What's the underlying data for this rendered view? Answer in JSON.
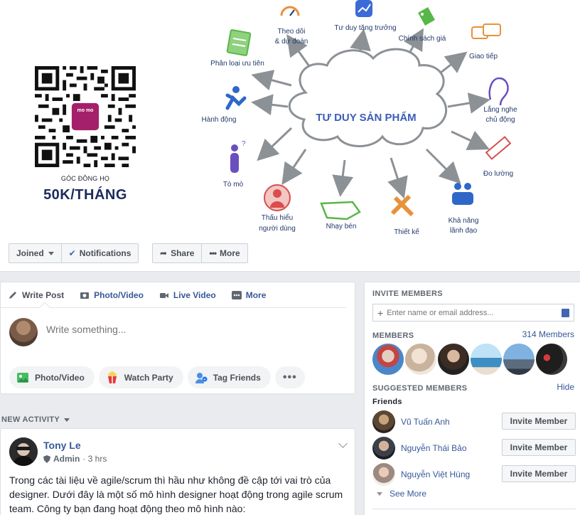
{
  "cover": {
    "qr_caption": "GÓC ĐỒNG HỌ",
    "qr_price": "50K/THÁNG",
    "qr_logo": "mo mo",
    "mindmap": {
      "center": "TƯ DUY SẢN PHẨM",
      "nodes": [
        {
          "label": "Theo dõi",
          "label2": "& dự đoán",
          "icon": "speedometer-icon"
        },
        {
          "label": "Tư duy tăng trưởng",
          "icon": "growth-chart-icon"
        },
        {
          "label": "Chính sách giá",
          "icon": "price-tag-icon"
        },
        {
          "label": "Giao tiếp",
          "icon": "chat-bubbles-icon"
        },
        {
          "label": "Lắng nghe",
          "label2": "chủ động",
          "icon": "ear-icon"
        },
        {
          "label": "Đo lường",
          "icon": "ruler-icon"
        },
        {
          "label": "Khả năng",
          "label2": "lãnh đạo",
          "icon": "team-icon"
        },
        {
          "label": "Thiết kế",
          "icon": "design-tools-icon"
        },
        {
          "label": "Nhạy bén",
          "icon": "map-icon"
        },
        {
          "label": "Thấu hiểu",
          "label2": "người dùng",
          "icon": "user-icon"
        },
        {
          "label": "Tò mò",
          "icon": "curious-person-icon"
        },
        {
          "label": "Hành động",
          "icon": "running-person-icon"
        },
        {
          "label": "Phân loại ưu tiên",
          "icon": "checklist-icon"
        }
      ]
    }
  },
  "actionbar": {
    "joined": "Joined",
    "notifications": "Notifications",
    "share": "Share",
    "more": "More"
  },
  "composer": {
    "tabs": [
      "Write Post",
      "Photo/Video",
      "Live Video",
      "More"
    ],
    "placeholder": "Write something...",
    "pills": [
      "Photo/Video",
      "Watch Party",
      "Tag Friends"
    ],
    "more_pill": "•••"
  },
  "feed": {
    "section_label": "NEW ACTIVITY",
    "post": {
      "author": "Tony Le",
      "role": "Admin",
      "time": "· 3 hrs",
      "text": "Trong các tài liệu về agile/scrum thì hầu như không đề cập tới vai trò của designer. Dưới đây là một số mô hình designer hoạt động trong agile scrum team. Công ty bạn đang hoạt động theo mô hình nào:"
    }
  },
  "sidebar": {
    "invite_heading": "INVITE MEMBERS",
    "invite_placeholder": "Enter name or email address...",
    "members_heading": "MEMBERS",
    "members_count": "314 Members",
    "suggested_heading": "SUGGESTED MEMBERS",
    "hide": "Hide",
    "friends_label": "Friends",
    "suggestions": [
      {
        "name": "Vũ Tuấn Anh",
        "button": "Invite Member"
      },
      {
        "name": "Nguyễn Thái Bảo",
        "button": "Invite Member"
      },
      {
        "name": "Nguyễn Việt Hùng",
        "button": "Invite Member"
      }
    ],
    "see_more": "See More"
  },
  "colors": {
    "link": "#365899",
    "cloud_text": "#3b5db6",
    "arrow": "#8c9196",
    "page_bg": "#e9ebee"
  }
}
